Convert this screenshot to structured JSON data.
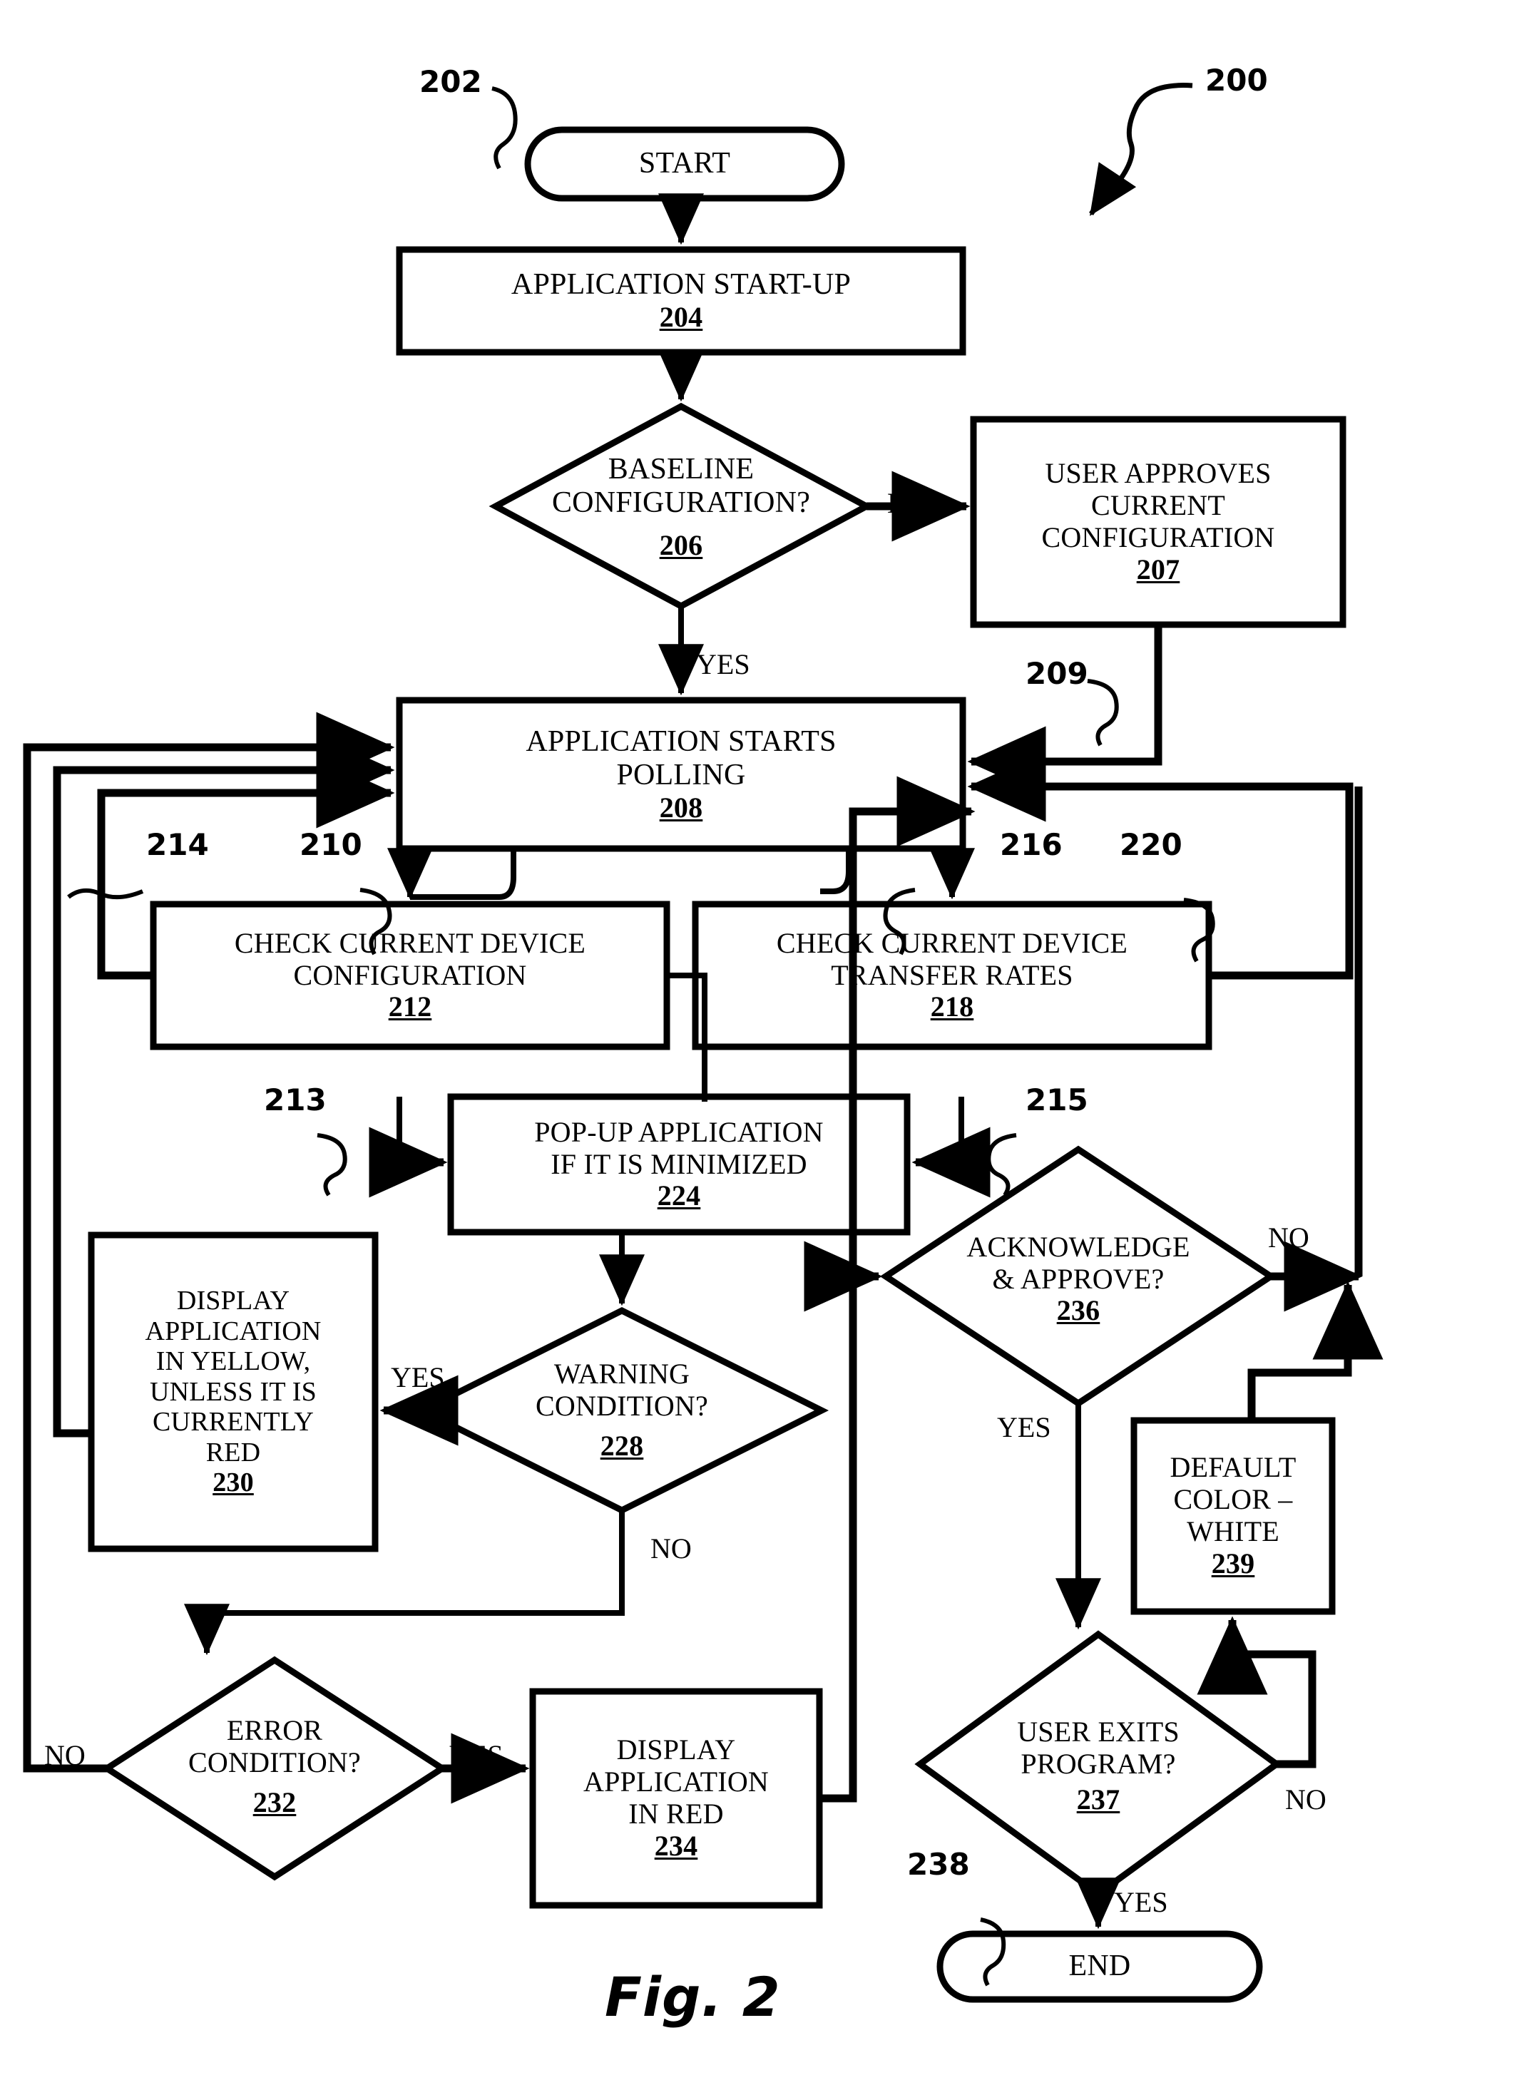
{
  "figure": {
    "caption": "Fig. 2",
    "diagram_ref": "200"
  },
  "nodes": {
    "start": {
      "label": "START",
      "ref": "202",
      "shape": "terminator"
    },
    "n204": {
      "line1": "APPLICATION START-UP",
      "ref": "204",
      "shape": "process"
    },
    "n206": {
      "line1": "BASELINE",
      "line2": "CONFIGURATION?",
      "ref": "206",
      "shape": "decision"
    },
    "n207": {
      "line1": "USER APPROVES",
      "line2": "CURRENT",
      "line3": "CONFIGURATION",
      "ref": "207",
      "shape": "process"
    },
    "n208": {
      "line1": "APPLICATION STARTS",
      "line2": "POLLING",
      "ref": "208",
      "shape": "process"
    },
    "n212": {
      "line1": "CHECK CURRENT DEVICE",
      "line2": "CONFIGURATION",
      "ref": "212",
      "shape": "process"
    },
    "n218": {
      "line1": "CHECK CURRENT DEVICE",
      "line2": "TRANSFER RATES",
      "ref": "218",
      "shape": "process"
    },
    "n224": {
      "line1": "POP-UP APPLICATION",
      "line2": "IF IT IS MINIMIZED",
      "ref": "224",
      "shape": "process"
    },
    "n228": {
      "line1": "WARNING",
      "line2": "CONDITION?",
      "ref": "228",
      "shape": "decision"
    },
    "n230": {
      "line1": "DISPLAY",
      "line2": "APPLICATION",
      "line3": "IN YELLOW,",
      "line4": "UNLESS IT IS",
      "line5": "CURRENTLY",
      "line6": "RED",
      "ref": "230",
      "shape": "process"
    },
    "n232": {
      "line1": "ERROR",
      "line2": "CONDITION?",
      "ref": "232",
      "shape": "decision"
    },
    "n234": {
      "line1": "DISPLAY",
      "line2": "APPLICATION",
      "line3": "IN RED",
      "ref": "234",
      "shape": "process"
    },
    "n236": {
      "line1": "ACKNOWLEDGE",
      "line2": "& APPROVE?",
      "ref": "236",
      "shape": "decision"
    },
    "n237": {
      "line1": "USER EXITS",
      "line2": "PROGRAM?",
      "ref": "237",
      "shape": "decision"
    },
    "n239": {
      "line1": "DEFAULT",
      "line2": "COLOR –",
      "line3": "WHITE",
      "ref": "239",
      "shape": "process"
    },
    "end": {
      "label": "END",
      "ref": "238",
      "shape": "terminator"
    }
  },
  "connector_refs": {
    "r209": "209",
    "r210": "210",
    "r213": "213",
    "r214": "214",
    "r215": "215",
    "r216": "216",
    "r220": "220"
  },
  "edge_labels": {
    "no_206": "NO",
    "yes_206": "YES",
    "yes_228": "YES",
    "no_228": "NO",
    "no_232": "NO",
    "yes_232": "YES",
    "no_236": "NO",
    "yes_236": "YES",
    "no_237": "NO",
    "yes_237": "YES"
  },
  "style": {
    "stroke": "#000000",
    "fill": "#ffffff",
    "background": "#ffffff"
  }
}
